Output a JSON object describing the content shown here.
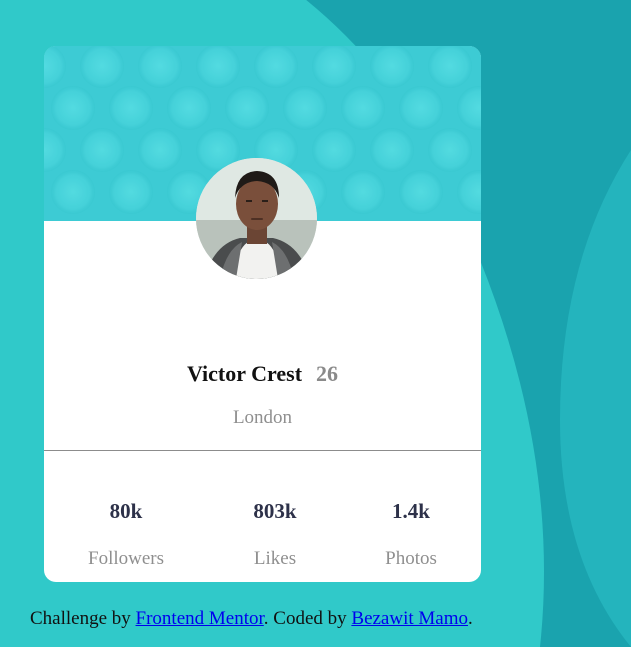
{
  "colors": {
    "background": "#1aa3ae",
    "background_shape": "#30c9c9",
    "card_header": "#3dcbd4",
    "card": "#ffffff",
    "name": "#111111",
    "muted_text": "#8f8f8f",
    "stat_value": "#2d3149",
    "link": "#0000ee"
  },
  "profile": {
    "name": "Victor Crest",
    "age": "26",
    "location": "London",
    "avatar_icon": "profile-photo"
  },
  "stats": [
    {
      "value": "80k",
      "label": "Followers"
    },
    {
      "value": "803k",
      "label": "Likes"
    },
    {
      "value": "1.4k",
      "label": "Photos"
    }
  ],
  "attribution": {
    "prefix": "Challenge by ",
    "link1": "Frontend Mentor",
    "middle": ". Coded by ",
    "link2": "Bezawit Mamo",
    "suffix": "."
  }
}
